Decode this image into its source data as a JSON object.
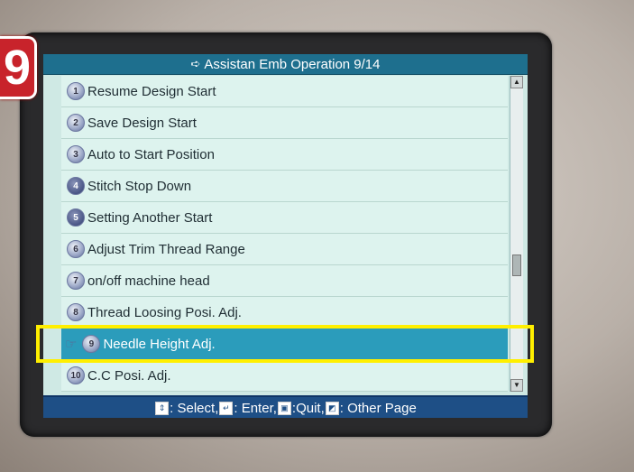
{
  "step_badge": "9",
  "title": {
    "icon": "arrow-pointer-icon",
    "text": "Assistan Emb Operation 9/14"
  },
  "menu_items": [
    {
      "num": "1",
      "label": "Resume Design Start",
      "icon_style": "light"
    },
    {
      "num": "2",
      "label": "Save Design Start",
      "icon_style": "light"
    },
    {
      "num": "3",
      "label": "Auto to Start Position",
      "icon_style": "light"
    },
    {
      "num": "4",
      "label": "Stitch Stop Down",
      "icon_style": "dark"
    },
    {
      "num": "5",
      "label": "Setting Another Start",
      "icon_style": "dark"
    },
    {
      "num": "6",
      "label": "Adjust Trim Thread Range",
      "icon_style": "light"
    },
    {
      "num": "7",
      "label": "on/off machine head",
      "icon_style": "light"
    },
    {
      "num": "8",
      "label": "Thread Loosing Posi. Adj.",
      "icon_style": "light"
    },
    {
      "num": "9",
      "label": "Needle Height Adj.",
      "icon_style": "light"
    },
    {
      "num": "10",
      "label": "C.C Posi. Adj.",
      "icon_style": "light"
    }
  ],
  "selected_index": 8,
  "status_bar": {
    "select_key": "⇕",
    "select": ": Select,",
    "enter_key": "↵",
    "enter": ": Enter,",
    "quit_key": "▣",
    "quit": ":Quit,",
    "other_key": "◩",
    "other": ": Other Page"
  },
  "colors": {
    "highlight": "#ffef00",
    "selected_row": "#2b9cbb",
    "titlebar": "#1e6f8e",
    "statusbar": "#1e4f86"
  }
}
